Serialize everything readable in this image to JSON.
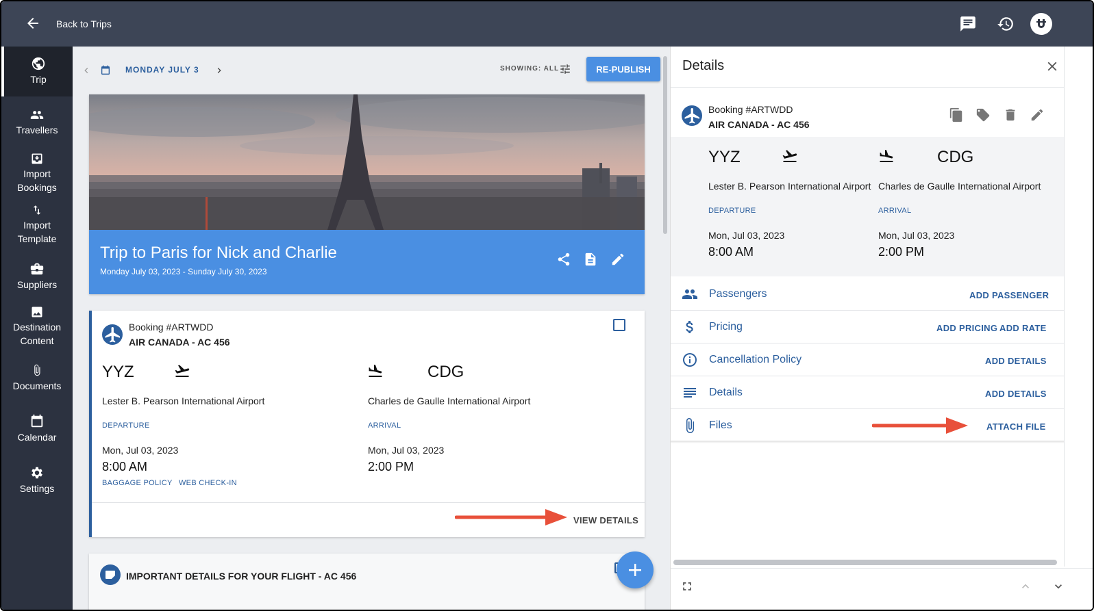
{
  "topbar": {
    "back_label": "Back to Trips"
  },
  "sidebar": {
    "items": [
      {
        "label": "Trip",
        "icon": "globe-icon"
      },
      {
        "label": "Travellers",
        "icon": "people-icon"
      },
      {
        "label": "Import Bookings",
        "icon": "import-icon"
      },
      {
        "label": "Import Template",
        "icon": "swap-vertical-icon"
      },
      {
        "label": "Suppliers",
        "icon": "briefcase-icon"
      },
      {
        "label": "Destination Content",
        "icon": "image-icon"
      },
      {
        "label": "Documents",
        "icon": "paperclip-icon"
      },
      {
        "label": "Calendar",
        "icon": "calendar-icon"
      },
      {
        "label": "Settings",
        "icon": "gear-icon"
      }
    ]
  },
  "main": {
    "date": "MONDAY JULY 3",
    "showing": "SHOWING: ALL",
    "republish": "RE-PUBLISH",
    "hero": {
      "title": "Trip to Paris for Nick and Charlie",
      "dates": "Monday July 03, 2023 - Sunday July 30, 2023"
    },
    "booking": {
      "number": "Booking #ARTWDD",
      "flight": "AIR CANADA - AC 456",
      "departure": {
        "code": "YYZ",
        "airport": "Lester B. Pearson International Airport",
        "tag": "DEPARTURE",
        "date": "Mon, Jul 03, 2023",
        "time": "8:00 AM"
      },
      "arrival": {
        "code": "CDG",
        "airport": "Charles de Gaulle International Airport",
        "tag": "ARRIVAL",
        "date": "Mon, Jul 03, 2023",
        "time": "2:00 PM"
      },
      "links": {
        "baggage": "BAGGAGE POLICY",
        "checkin": "WEB CHECK-IN"
      },
      "view_details": "VIEW DETAILS"
    },
    "info_card": {
      "title": "IMPORTANT DETAILS FOR YOUR FLIGHT - AC 456"
    }
  },
  "panel": {
    "title": "Details",
    "booking": {
      "number": "Booking #ARTWDD",
      "flight": "AIR CANADA - AC 456",
      "departure": {
        "code": "YYZ",
        "airport": "Lester B. Pearson International Airport",
        "tag": "DEPARTURE",
        "date": "Mon, Jul 03, 2023",
        "time": "8:00 AM"
      },
      "arrival": {
        "code": "CDG",
        "airport": "Charles de Gaulle International Airport",
        "tag": "ARRIVAL",
        "date": "Mon, Jul 03, 2023",
        "time": "2:00 PM"
      }
    },
    "rows": [
      {
        "label": "Passengers",
        "icon": "people-icon",
        "actions": [
          "ADD PASSENGER"
        ]
      },
      {
        "label": "Pricing",
        "icon": "dollar-icon",
        "actions": [
          "ADD PRICING",
          "ADD RATE"
        ]
      },
      {
        "label": "Cancellation Policy",
        "icon": "info-icon",
        "actions": [
          "ADD DETAILS"
        ]
      },
      {
        "label": "Details",
        "icon": "lines-icon",
        "actions": [
          "ADD DETAILS"
        ]
      },
      {
        "label": "Files",
        "icon": "paperclip-icon",
        "actions": [
          "ATTACH FILE"
        ]
      }
    ]
  },
  "colors": {
    "topbar": "#3d4556",
    "sidebar": "#2c3240",
    "accent": "#4a8fe2",
    "link": "#2c5f9e",
    "annotation": "#e8503a"
  }
}
